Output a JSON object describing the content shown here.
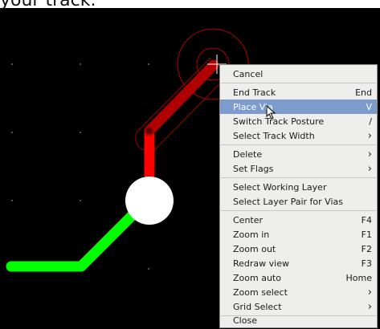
{
  "caption": {
    "text": "your track."
  },
  "menu": {
    "items": [
      {
        "label": "Cancel",
        "shortcut": ""
      },
      {
        "label": "End Track",
        "shortcut": "End"
      },
      {
        "label": "Place Via",
        "shortcut": "V",
        "highlighted": true
      },
      {
        "label": "Switch Track Posture",
        "shortcut": "/"
      },
      {
        "label": "Select Track Width",
        "shortcut": "›"
      },
      {
        "label": "Delete",
        "shortcut": "›"
      },
      {
        "label": "Set Flags",
        "shortcut": "›"
      },
      {
        "label": "Select Working Layer",
        "shortcut": ""
      },
      {
        "label": "Select Layer Pair for Vias",
        "shortcut": ""
      },
      {
        "label": "Center",
        "shortcut": "F4"
      },
      {
        "label": "Zoom in",
        "shortcut": "F1"
      },
      {
        "label": "Zoom out",
        "shortcut": "F2"
      },
      {
        "label": "Redraw view",
        "shortcut": "F3"
      },
      {
        "label": "Zoom auto",
        "shortcut": "Home"
      },
      {
        "label": "Zoom select",
        "shortcut": "›"
      },
      {
        "label": "Grid Select",
        "shortcut": "›"
      },
      {
        "label": "Close",
        "shortcut": ""
      }
    ]
  },
  "colors": {
    "canvas_bg": "#000000",
    "track_red": "#ff0000",
    "track_dark_red": "#b00000",
    "track_green": "#00ff00",
    "pad": "#ffffff",
    "highlight": "#7d9ccc"
  }
}
